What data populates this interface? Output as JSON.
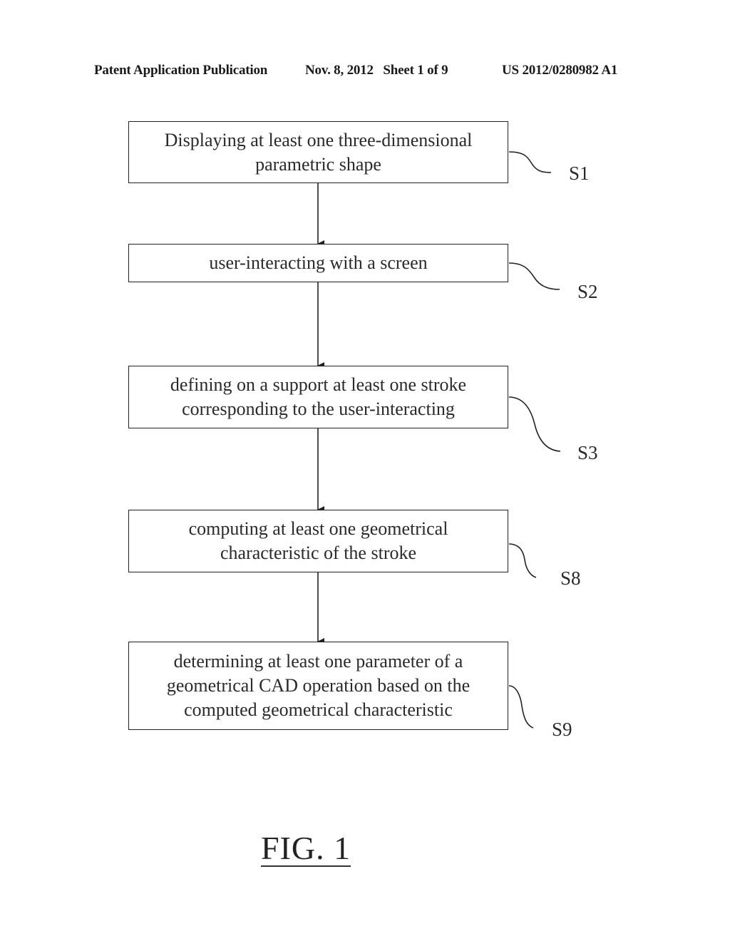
{
  "header": {
    "publication": "Patent Application Publication",
    "date_sheet": "Nov. 8, 2012   Sheet 1 of 9",
    "number": "US 2012/0280982 A1"
  },
  "steps": [
    {
      "id": "S1",
      "lines": [
        "Displaying at least one three-dimensional",
        "parametric shape"
      ]
    },
    {
      "id": "S2",
      "lines": [
        "user-interacting with a screen"
      ]
    },
    {
      "id": "S3",
      "lines": [
        "defining on a support at least one stroke",
        "corresponding to the user-interacting"
      ]
    },
    {
      "id": "S8",
      "lines": [
        "computing at least one geometrical",
        "characteristic of the stroke"
      ]
    },
    {
      "id": "S9",
      "lines": [
        "determining at least one parameter of a",
        "geometrical CAD operation based on the",
        "computed geometrical characteristic"
      ]
    }
  ],
  "figure_label": "FIG. 1"
}
